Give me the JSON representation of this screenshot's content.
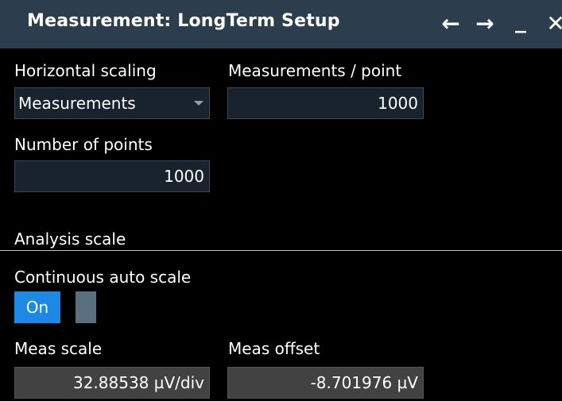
{
  "window": {
    "title": "Measurement: LongTerm Setup",
    "controls": {
      "back": "←",
      "forward": "→",
      "minimize": "_",
      "close": "✕"
    }
  },
  "horizontal_scaling": {
    "label": "Horizontal scaling",
    "value": "Measurements"
  },
  "measurements_per_point": {
    "label": "Measurements / point",
    "value": "1000"
  },
  "number_of_points": {
    "label": "Number of points",
    "value": "1000"
  },
  "analysis_scale": {
    "section_title": "Analysis scale"
  },
  "continuous_auto_scale": {
    "label": "Continuous auto scale",
    "toggle_text": "On"
  },
  "meas_scale": {
    "label": "Meas scale",
    "value": "32.88538 µV/div"
  },
  "meas_offset": {
    "label": "Meas offset",
    "value": "-8.701976 µV"
  },
  "colors": {
    "titlebar": "#2c3e4e",
    "background": "#000000",
    "input_field": "#18232d",
    "readonly_field": "#424242",
    "toggle_on": "#1e88e5"
  }
}
